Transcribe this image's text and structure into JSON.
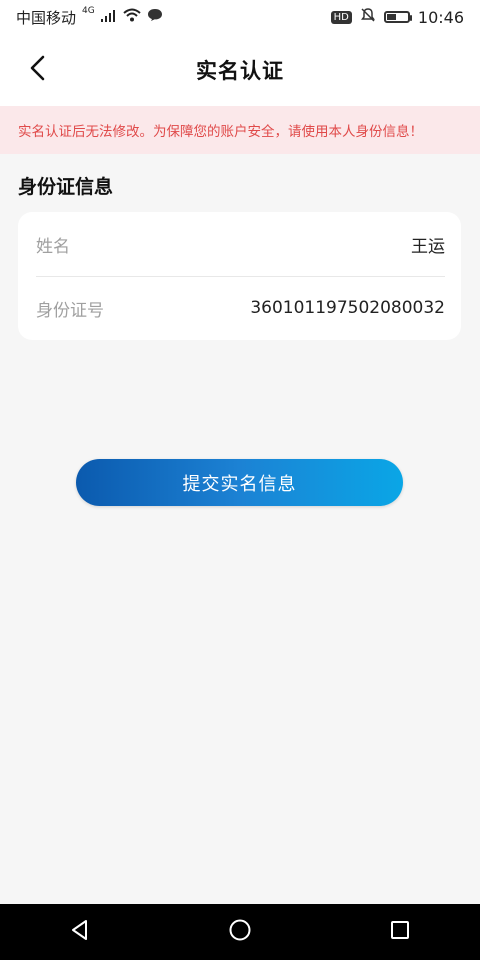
{
  "status_bar": {
    "carrier": "中国移动",
    "network": "4G",
    "time": "10:46",
    "hd_label": "HD",
    "battery_level": 0.4
  },
  "header": {
    "title": "实名认证"
  },
  "banner": {
    "text": "实名认证后无法修改。为保障您的账户安全，请使用本人身份信息！"
  },
  "section": {
    "title": "身份证信息"
  },
  "form": {
    "name_label": "姓名",
    "name_value": "王运",
    "id_label": "身份证号",
    "id_value": "360101197502080032"
  },
  "actions": {
    "submit_label": "提交实名信息"
  },
  "colors": {
    "accent_start": "#0b5aae",
    "accent_end": "#0aa6e6",
    "warning_text": "#e04a4a",
    "warning_bg": "#fbe8ea"
  },
  "icons": {
    "back": "chevron-left-icon",
    "nav_back": "triangle-back-icon",
    "nav_home": "circle-home-icon",
    "nav_recent": "square-recent-icon"
  }
}
